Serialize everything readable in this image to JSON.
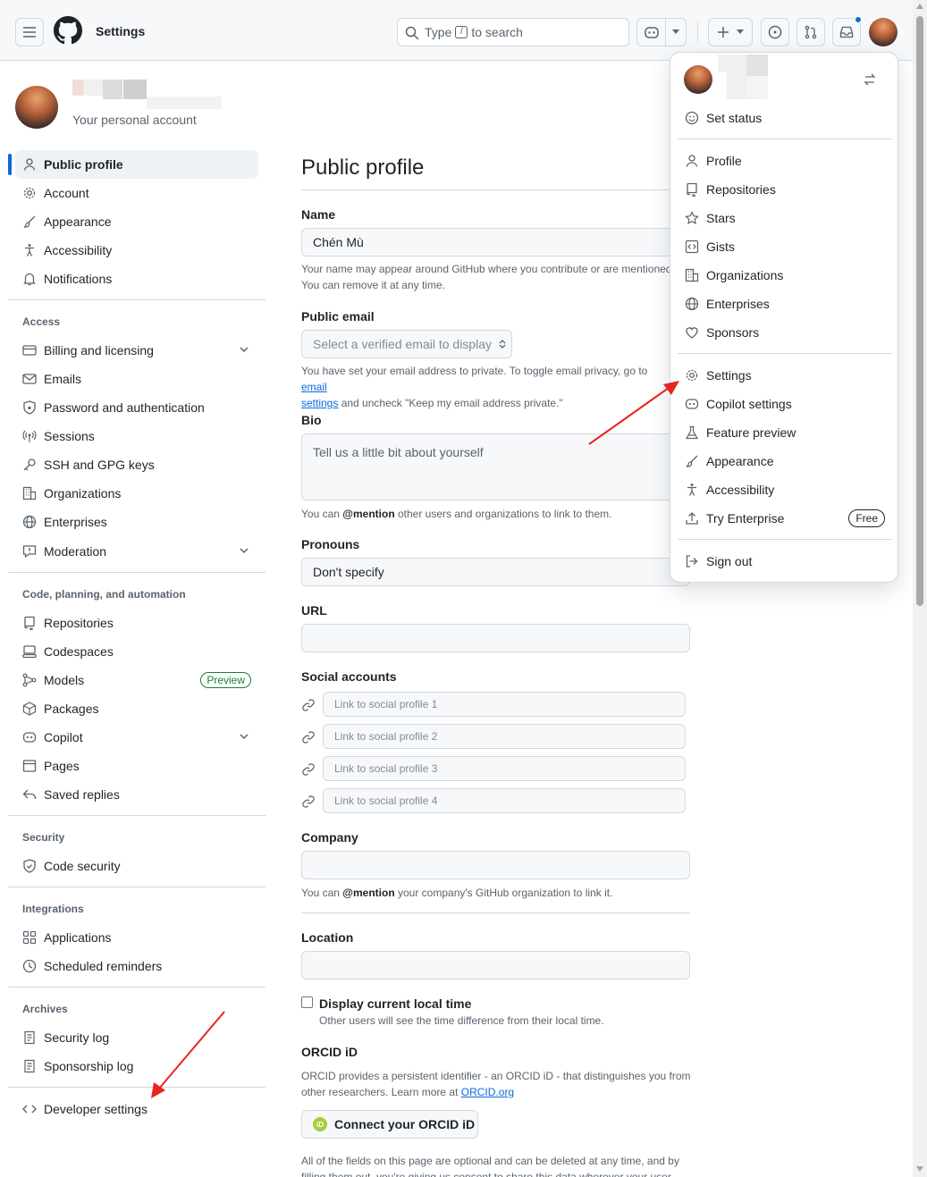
{
  "header": {
    "title": "Settings",
    "search_prefix": "Type",
    "search_key": "/",
    "search_suffix": "to search"
  },
  "account": {
    "subtitle": "Your personal account"
  },
  "sidebar": {
    "items": [
      {
        "label": "Public profile",
        "icon": "person-icon"
      },
      {
        "label": "Account",
        "icon": "gear-icon"
      },
      {
        "label": "Appearance",
        "icon": "paintbrush-icon"
      },
      {
        "label": "Accessibility",
        "icon": "accessibility-icon"
      },
      {
        "label": "Notifications",
        "icon": "bell-icon"
      }
    ],
    "access_title": "Access",
    "access_items": [
      {
        "label": "Billing and licensing",
        "icon": "credit-card-icon"
      },
      {
        "label": "Emails",
        "icon": "mail-icon"
      },
      {
        "label": "Password and authentication",
        "icon": "shield-lock-icon"
      },
      {
        "label": "Sessions",
        "icon": "broadcast-icon"
      },
      {
        "label": "SSH and GPG keys",
        "icon": "key-icon"
      },
      {
        "label": "Organizations",
        "icon": "organization-icon"
      },
      {
        "label": "Enterprises",
        "icon": "globe-icon"
      },
      {
        "label": "Moderation",
        "icon": "report-icon"
      }
    ],
    "code_title": "Code, planning, and automation",
    "code_items": [
      {
        "label": "Repositories",
        "icon": "repo-icon"
      },
      {
        "label": "Codespaces",
        "icon": "codespaces-icon"
      },
      {
        "label": "Models",
        "icon": "models-icon"
      },
      {
        "label": "Packages",
        "icon": "package-icon"
      },
      {
        "label": "Copilot",
        "icon": "copilot-icon"
      },
      {
        "label": "Pages",
        "icon": "browser-icon"
      },
      {
        "label": "Saved replies",
        "icon": "reply-icon"
      }
    ],
    "models_badge": "Preview",
    "security_title": "Security",
    "security_items": [
      {
        "label": "Code security",
        "icon": "shield-check-icon"
      }
    ],
    "integrations_title": "Integrations",
    "integrations_items": [
      {
        "label": "Applications",
        "icon": "apps-icon"
      },
      {
        "label": "Scheduled reminders",
        "icon": "clock-icon"
      }
    ],
    "archives_title": "Archives",
    "archives_items": [
      {
        "label": "Security log",
        "icon": "log-icon"
      },
      {
        "label": "Sponsorship log",
        "icon": "log-icon"
      }
    ],
    "developer_settings": "Developer settings"
  },
  "main": {
    "title": "Public profile",
    "name_label": "Name",
    "name_value": "Chén Mù",
    "name_help_1": "Your name may appear around GitHub where you contribute or are mentioned.",
    "name_help_2": "You can remove it at any time.",
    "email_label": "Public email",
    "email_placeholder": "Select a verified email to display",
    "email_help_1": "You have set your email address to private. To toggle email privacy, go to",
    "email_help_link": "email",
    "email_help_link2": "settings",
    "email_help_2": "and uncheck \"Keep my email address private.\"",
    "bio_label": "Bio",
    "bio_placeholder": "Tell us a little bit about yourself",
    "bio_help_prefix": "You can",
    "bio_help_mention": "@mention",
    "bio_help_suffix": "other users and organizations to link to them.",
    "pronouns_label": "Pronouns",
    "pronouns_value": "Don't specify",
    "url_label": "URL",
    "social_label": "Social accounts",
    "social_placeholders": [
      "Link to social profile 1",
      "Link to social profile 2",
      "Link to social profile 3",
      "Link to social profile 4"
    ],
    "company_label": "Company",
    "company_help_prefix": "You can",
    "company_help_mention": "@mention",
    "company_help_suffix": "your company's GitHub organization to link it.",
    "location_label": "Location",
    "time_label": "Display current local time",
    "time_help": "Other users will see the time difference from their local time.",
    "orcid_label": "ORCID iD",
    "orcid_help_1": "ORCID provides a persistent identifier - an ORCID iD - that distinguishes you from",
    "orcid_help_2": "other researchers. Learn more at",
    "orcid_link": "ORCID.org",
    "orcid_button": "Connect your ORCID iD",
    "footer_1": "All of the fields on this page are optional and can be deleted at any time, and by",
    "footer_2": "filling them out, you're giving us consent to share this data wherever your user"
  },
  "menu": {
    "set_status": "Set status",
    "group1": [
      "Profile",
      "Repositories",
      "Stars",
      "Gists",
      "Organizations",
      "Enterprises",
      "Sponsors"
    ],
    "group2": [
      "Settings",
      "Copilot settings",
      "Feature preview",
      "Appearance",
      "Accessibility",
      "Try Enterprise"
    ],
    "free_badge": "Free",
    "sign_out": "Sign out"
  },
  "colors": {
    "accent": "#0969da",
    "annotation_arrow": "#e8251f"
  }
}
